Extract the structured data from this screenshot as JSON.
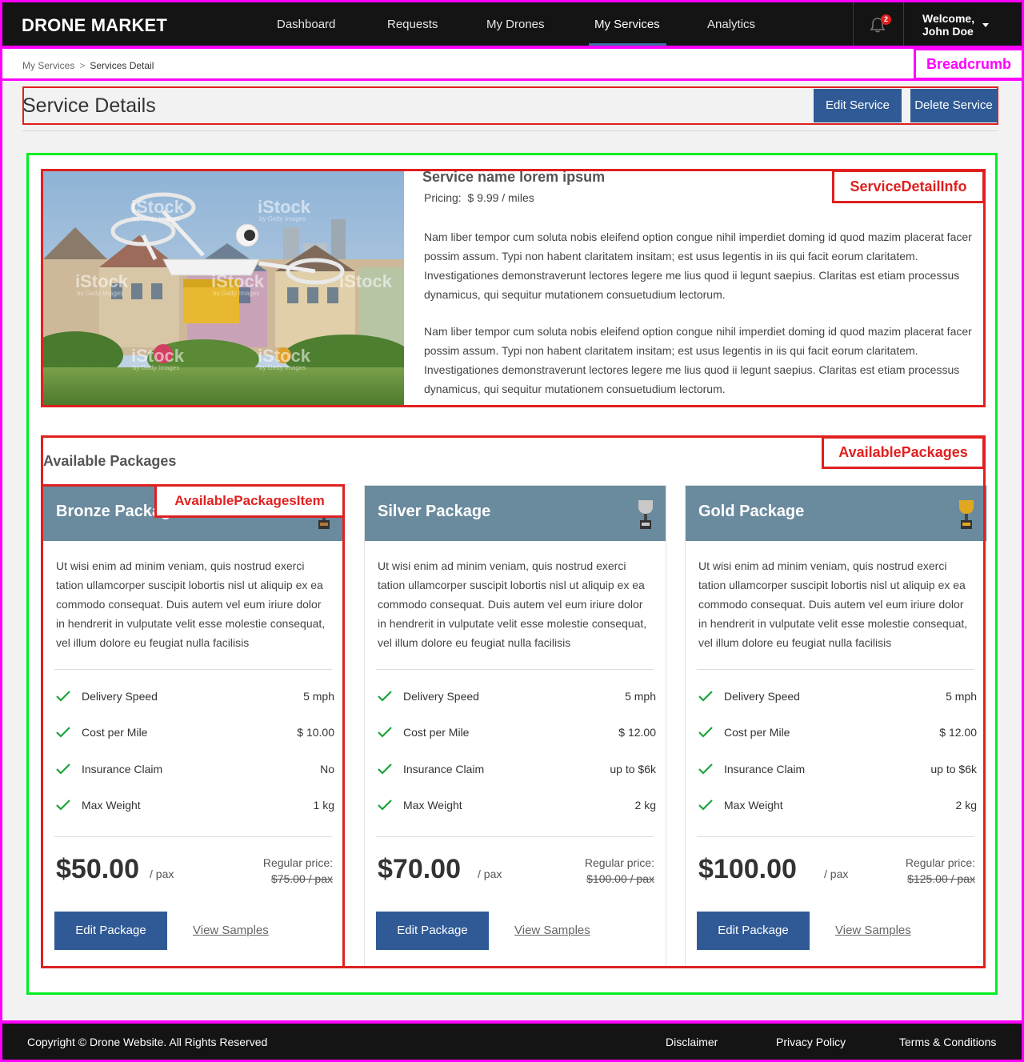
{
  "header": {
    "logo": "DRONE MARKET",
    "nav": [
      "Dashboard",
      "Requests",
      "My Drones",
      "My Services",
      "Analytics"
    ],
    "active_nav": "My Services",
    "notification_count": "2",
    "welcome_line1": "Welcome,",
    "welcome_line2": "John Doe"
  },
  "breadcrumb": {
    "parent": "My Services",
    "separator": ">",
    "current": "Services Detail",
    "annotation": "Breadcrumb"
  },
  "page": {
    "title": "Service Details",
    "edit_label": "Edit Service",
    "delete_label": "Delete Service"
  },
  "service": {
    "annotation": "ServiceDetailInfo",
    "name": "Service name lorem ipsum",
    "pricing_label": "Pricing:",
    "pricing_value": "$ 9.99 / miles",
    "paragraphs": [
      "Nam liber tempor cum soluta nobis eleifend option congue nihil imperdiet doming id quod mazim placerat facer possim assum. Typi non habent claritatem insitam; est usus legentis in iis qui facit eorum claritatem. Investigationes demonstraverunt lectores legere me lius quod ii legunt saepius. Claritas est etiam processus dynamicus, qui sequitur mutationem consuetudium lectorum.",
      "Nam liber tempor cum soluta nobis eleifend option congue nihil imperdiet doming id quod mazim placerat facer possim assum. Typi non habent claritatem insitam; est usus legentis in iis qui facit eorum claritatem. Investigationes demonstraverunt lectores legere me lius quod ii legunt saepius. Claritas est etiam processus dynamicus, qui sequitur mutationem consuetudium lectorum."
    ],
    "image_watermark": "iStock",
    "image_watermark_sub": "by Getty Images"
  },
  "packages": {
    "annotation": "AvailablePackages",
    "item_annotation": "AvailablePackagesItem",
    "title": "Available Packages",
    "items": [
      {
        "name": "Bronze Package",
        "trophy_color": "#b07a3a",
        "description": "Ut wisi enim ad minim veniam, quis nostrud exerci tation ullamcorper suscipit lobortis nisl ut aliquip ex ea commodo consequat. Duis autem vel eum iriure dolor in hendrerit in vulputate velit esse molestie consequat, vel illum dolore eu feugiat nulla facilisis",
        "features": [
          {
            "label": "Delivery Speed",
            "value": "5 mph"
          },
          {
            "label": "Cost per Mile",
            "value": "$ 10.00"
          },
          {
            "label": "Insurance Claim",
            "value": "No"
          },
          {
            "label": "Max Weight",
            "value": "1 kg"
          }
        ],
        "price": "$50.00",
        "unit": "/ pax",
        "regular_label": "Regular price:",
        "regular_price": "$75.00 / pax",
        "edit_label": "Edit Package",
        "samples_label": "View Samples"
      },
      {
        "name": "Silver Package",
        "trophy_color": "#c8c8c8",
        "description": "Ut wisi enim ad minim veniam, quis nostrud exerci tation ullamcorper suscipit lobortis nisl ut aliquip ex ea commodo consequat. Duis autem vel eum iriure dolor in hendrerit in vulputate velit esse molestie consequat, vel illum dolore eu feugiat nulla facilisis",
        "features": [
          {
            "label": "Delivery Speed",
            "value": "5 mph"
          },
          {
            "label": "Cost per Mile",
            "value": "$ 12.00"
          },
          {
            "label": "Insurance Claim",
            "value": "up to $6k"
          },
          {
            "label": "Max Weight",
            "value": "2 kg"
          }
        ],
        "price": "$70.00",
        "unit": "/ pax",
        "regular_label": "Regular price:",
        "regular_price": "$100.00 / pax",
        "edit_label": "Edit Package",
        "samples_label": "View Samples"
      },
      {
        "name": "Gold Package",
        "trophy_color": "#e0a820",
        "description": "Ut wisi enim ad minim veniam, quis nostrud exerci tation ullamcorper suscipit lobortis nisl ut aliquip ex ea commodo consequat. Duis autem vel eum iriure dolor in hendrerit in vulputate velit esse molestie consequat, vel illum dolore eu feugiat nulla facilisis",
        "features": [
          {
            "label": "Delivery Speed",
            "value": "5 mph"
          },
          {
            "label": "Cost per Mile",
            "value": "$ 12.00"
          },
          {
            "label": "Insurance Claim",
            "value": "up to $6k"
          },
          {
            "label": "Max Weight",
            "value": "2 kg"
          }
        ],
        "price": "$100.00",
        "unit": "/ pax",
        "regular_label": "Regular price:",
        "regular_price": "$125.00 / pax",
        "edit_label": "Edit Package",
        "samples_label": "View Samples"
      }
    ]
  },
  "footer": {
    "copyright": "Copyright © Drone Website. All Rights Reserved",
    "links": [
      "Disclaimer",
      "Privacy Policy",
      "Terms & Conditions"
    ]
  },
  "colors": {
    "header_bg": "#141414",
    "accent": "#2f5a96",
    "card_header": "#6a8a9e",
    "check": "#1aa33a",
    "annotation_magenta": "#ff00ff",
    "annotation_red": "#e02020",
    "annotation_green": "#00ee22"
  }
}
